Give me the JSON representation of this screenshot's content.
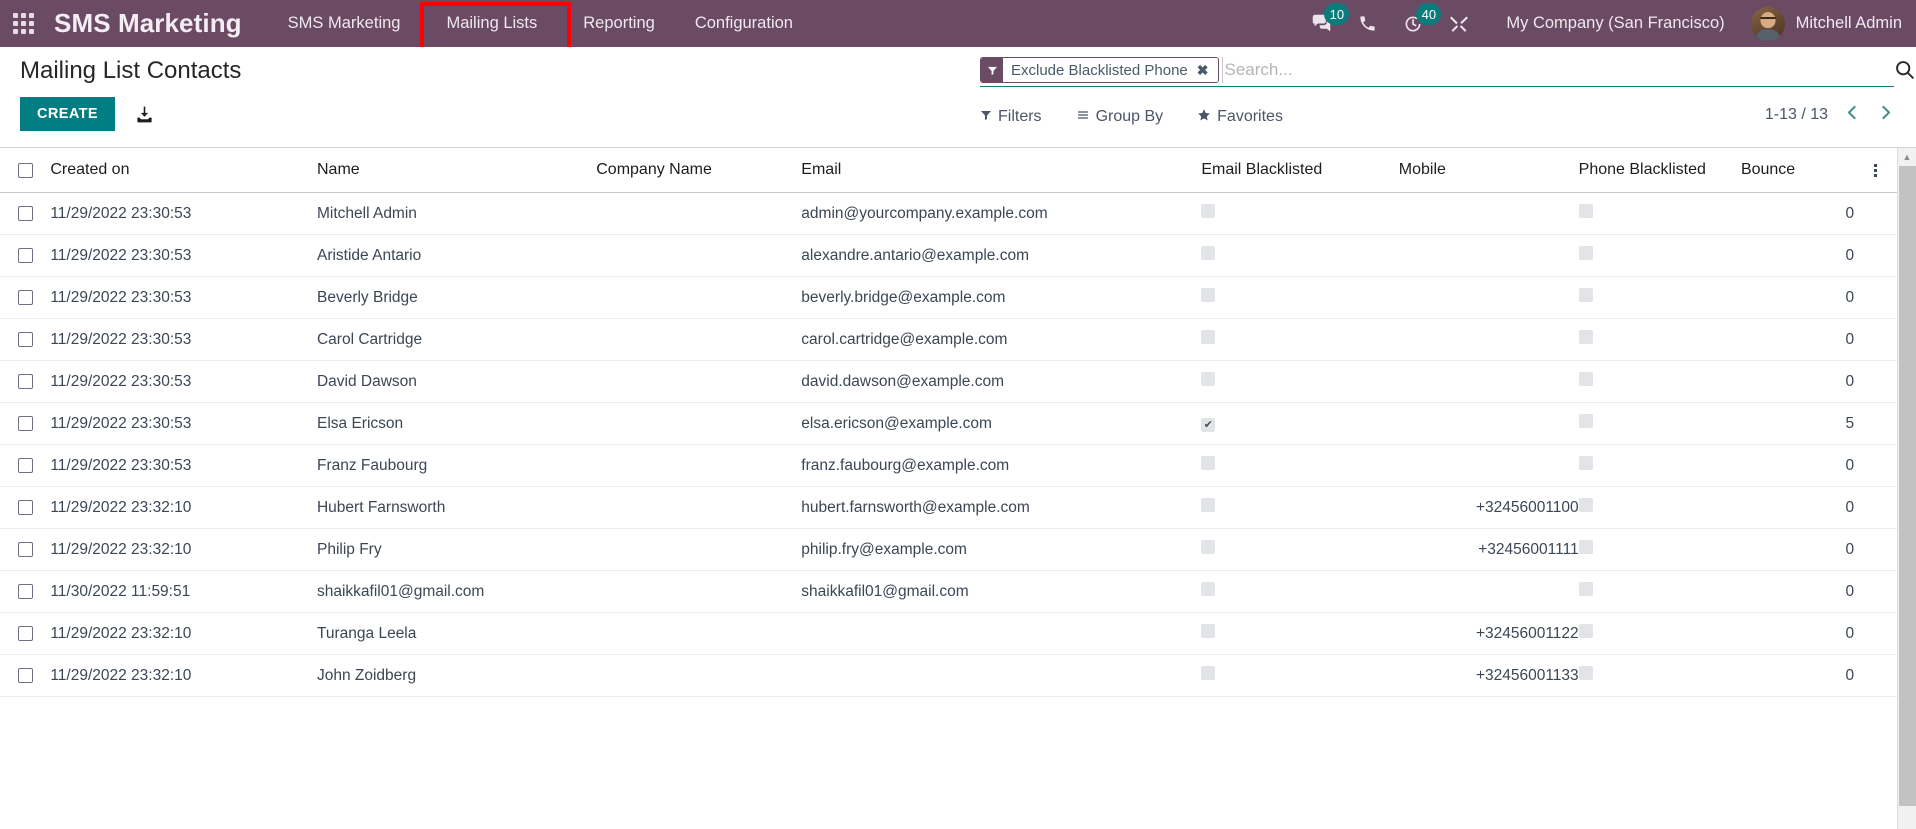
{
  "navbar": {
    "apps_icon": "apps-grid-icon",
    "brand": "SMS Marketing",
    "menu_items": [
      {
        "label": "SMS Marketing",
        "highlighted": false
      },
      {
        "label": "Mailing Lists",
        "highlighted": true
      },
      {
        "label": "Reporting",
        "highlighted": false
      },
      {
        "label": "Configuration",
        "highlighted": false
      }
    ],
    "systray": {
      "messages_badge": "10",
      "activities_badge": "40"
    },
    "company": "My Company (San Francisco)",
    "user": "Mitchell Admin"
  },
  "control_panel": {
    "title": "Mailing List Contacts",
    "create_label": "CREATE",
    "import_icon": "import-icon",
    "search": {
      "facet_label": "Exclude Blacklisted Phone",
      "facet_remove": "✖",
      "placeholder": "Search...",
      "value": ""
    },
    "toolbar": {
      "filters": "Filters",
      "group_by": "Group By",
      "favorites": "Favorites"
    },
    "pager": {
      "count": "1-13 / 13",
      "prev": "‹",
      "next": "›"
    }
  },
  "table": {
    "columns": [
      "Created on",
      "Name",
      "Company Name",
      "Email",
      "Email Blacklisted",
      "Mobile",
      "Phone Blacklisted",
      "Bounce"
    ],
    "rows": [
      {
        "created_on": "11/29/2022 23:30:53",
        "name": "Mitchell Admin",
        "company_name": "",
        "email": "admin@yourcompany.example.com",
        "email_blacklisted": false,
        "mobile": "",
        "phone_blacklisted": false,
        "bounce": "0"
      },
      {
        "created_on": "11/29/2022 23:30:53",
        "name": "Aristide Antario",
        "company_name": "",
        "email": "alexandre.antario@example.com",
        "email_blacklisted": false,
        "mobile": "",
        "phone_blacklisted": false,
        "bounce": "0"
      },
      {
        "created_on": "11/29/2022 23:30:53",
        "name": "Beverly Bridge",
        "company_name": "",
        "email": "beverly.bridge@example.com",
        "email_blacklisted": false,
        "mobile": "",
        "phone_blacklisted": false,
        "bounce": "0"
      },
      {
        "created_on": "11/29/2022 23:30:53",
        "name": "Carol Cartridge",
        "company_name": "",
        "email": "carol.cartridge@example.com",
        "email_blacklisted": false,
        "mobile": "",
        "phone_blacklisted": false,
        "bounce": "0"
      },
      {
        "created_on": "11/29/2022 23:30:53",
        "name": "David Dawson",
        "company_name": "",
        "email": "david.dawson@example.com",
        "email_blacklisted": false,
        "mobile": "",
        "phone_blacklisted": false,
        "bounce": "0"
      },
      {
        "created_on": "11/29/2022 23:30:53",
        "name": "Elsa Ericson",
        "company_name": "",
        "email": "elsa.ericson@example.com",
        "email_blacklisted": true,
        "mobile": "",
        "phone_blacklisted": false,
        "bounce": "5"
      },
      {
        "created_on": "11/29/2022 23:30:53",
        "name": "Franz Faubourg",
        "company_name": "",
        "email": "franz.faubourg@example.com",
        "email_blacklisted": false,
        "mobile": "",
        "phone_blacklisted": false,
        "bounce": "0"
      },
      {
        "created_on": "11/29/2022 23:32:10",
        "name": "Hubert Farnsworth",
        "company_name": "",
        "email": "hubert.farnsworth@example.com",
        "email_blacklisted": false,
        "mobile": "+32456001100",
        "phone_blacklisted": false,
        "bounce": "0"
      },
      {
        "created_on": "11/29/2022 23:32:10",
        "name": "Philip Fry",
        "company_name": "",
        "email": "philip.fry@example.com",
        "email_blacklisted": false,
        "mobile": "+32456001111",
        "phone_blacklisted": false,
        "bounce": "0"
      },
      {
        "created_on": "11/30/2022 11:59:51",
        "name": "shaikkafil01@gmail.com",
        "company_name": "",
        "email": "shaikkafil01@gmail.com",
        "email_blacklisted": false,
        "mobile": "",
        "phone_blacklisted": false,
        "bounce": "0"
      },
      {
        "created_on": "11/29/2022 23:32:10",
        "name": "Turanga Leela",
        "company_name": "",
        "email": "",
        "email_blacklisted": false,
        "mobile": "+32456001122",
        "phone_blacklisted": false,
        "bounce": "0"
      },
      {
        "created_on": "11/29/2022 23:32:10",
        "name": "John Zoidberg",
        "company_name": "",
        "email": "",
        "email_blacklisted": false,
        "mobile": "+32456001133",
        "phone_blacklisted": false,
        "bounce": "0"
      }
    ],
    "checkmark": "✔"
  },
  "colors": {
    "navbar_bg": "#6b4a63",
    "accent_teal": "#017e84",
    "badge_teal": "#0a7c7c",
    "highlight_red": "#fe0000",
    "pager_chevron": "#4b8f92"
  }
}
